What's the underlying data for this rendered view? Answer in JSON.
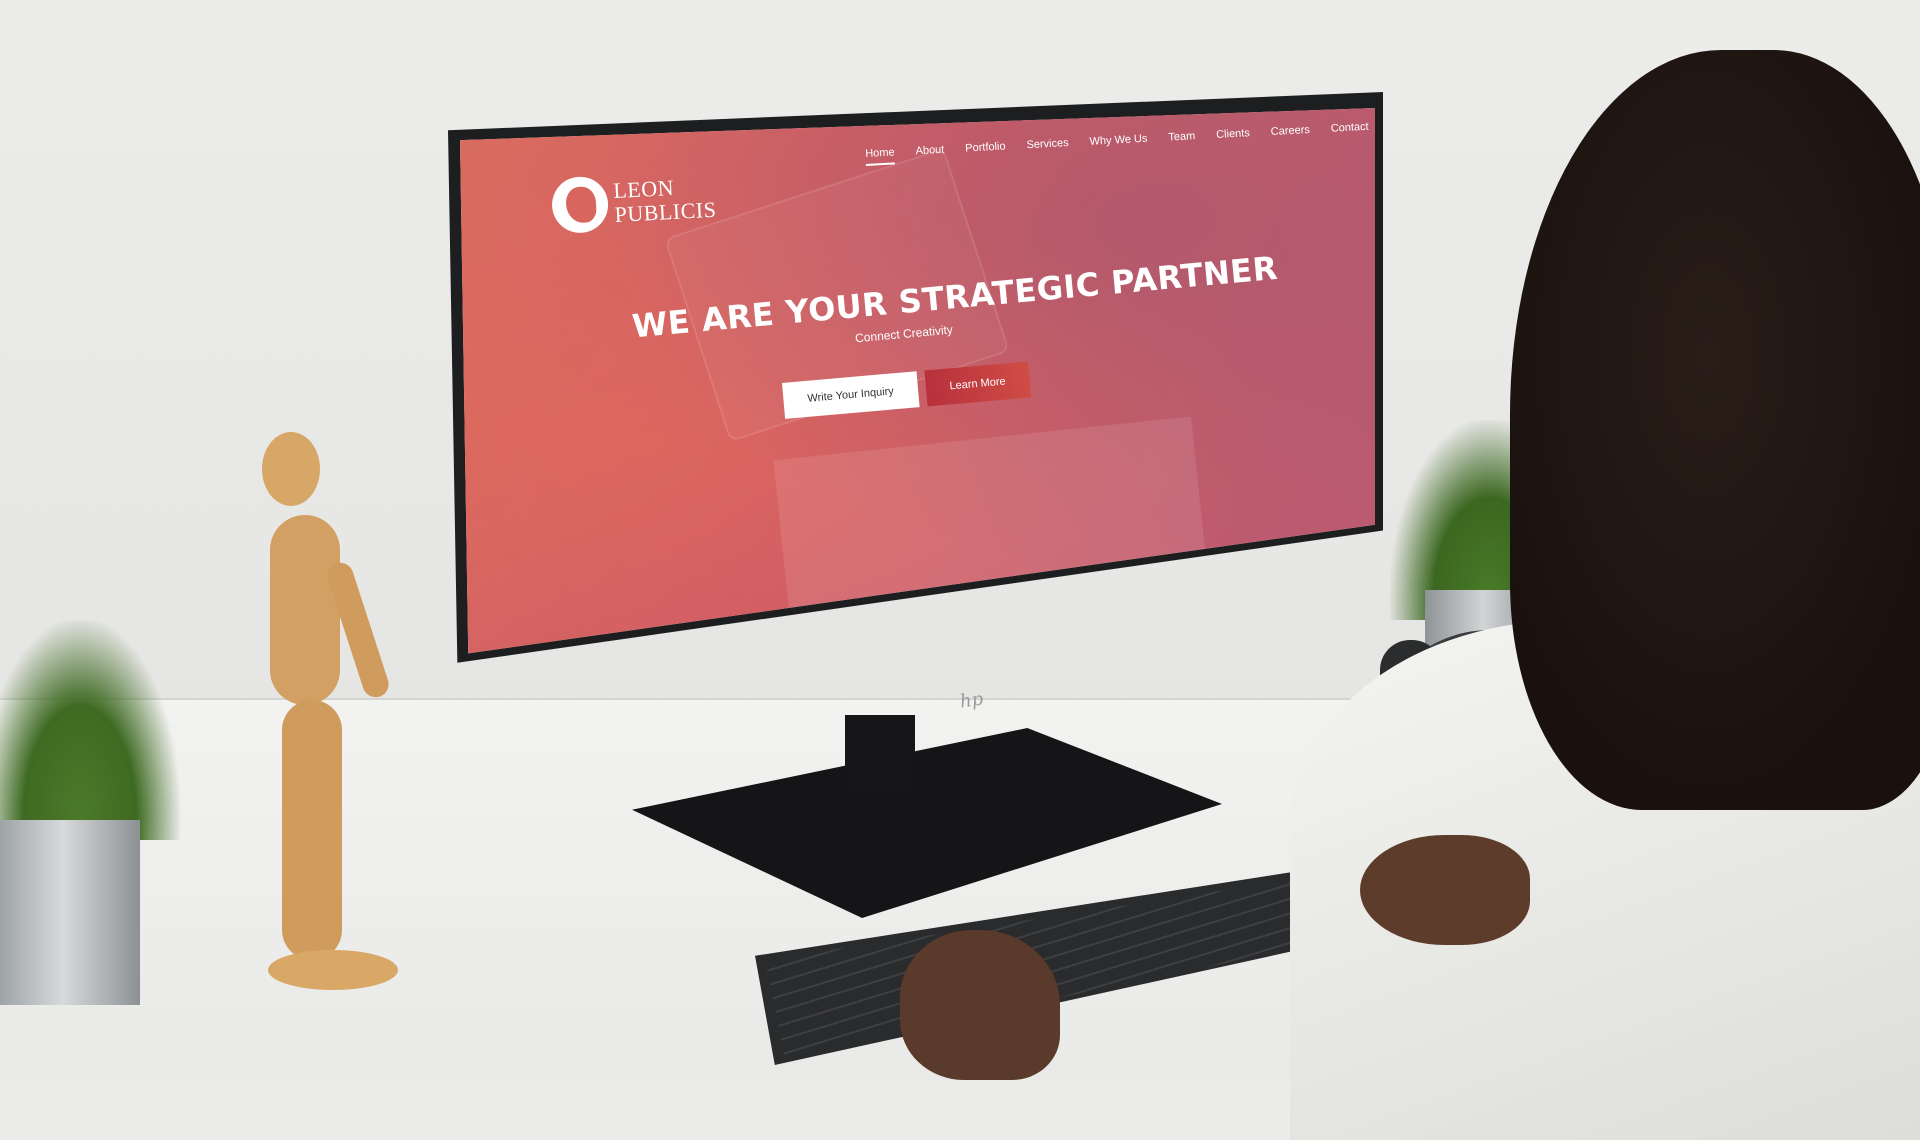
{
  "site": {
    "logo": {
      "line1": "LEON",
      "line2": "PUBLICIS",
      "icon": "lion-head-icon"
    },
    "nav": [
      {
        "label": "Home",
        "active": true
      },
      {
        "label": "About"
      },
      {
        "label": "Portfolio"
      },
      {
        "label": "Services"
      },
      {
        "label": "Why We Us"
      },
      {
        "label": "Team"
      },
      {
        "label": "Clients"
      },
      {
        "label": "Careers"
      },
      {
        "label": "Contact"
      }
    ],
    "hero": {
      "headline": "WE ARE YOUR STRATEGIC PARTNER",
      "subheadline": "Connect Creativity",
      "primary_button": "Write Your Inquiry",
      "secondary_button": "Learn More"
    }
  },
  "monitor": {
    "brand_mark": "hp"
  },
  "colors": {
    "hero_start": "#d96c5f",
    "hero_end": "#b85a72",
    "accent_button": "#b7303c"
  }
}
